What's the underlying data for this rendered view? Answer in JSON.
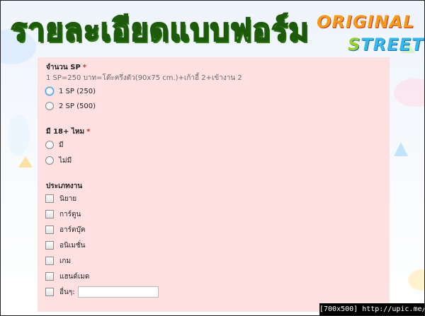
{
  "header": {
    "title": "รายละเอียดแบบฟอร์ม",
    "logo_line1": "ORIGINAL",
    "logo_line2_a": "S",
    "logo_line2_b": "TREET"
  },
  "form": {
    "q1": {
      "label": "จำนวน SP",
      "required_mark": "*",
      "help": "1 SP=250 บาท=โต๊ะครึ่งตัว(90x75 cm.)+เก้าอี้ 2+เข้างาน 2",
      "options": [
        "1 SP (250)",
        "2 SP (500)"
      ]
    },
    "q2": {
      "label": "มี 18+ ไหม",
      "required_mark": "*",
      "options": [
        "มี",
        "ไม่มี"
      ]
    },
    "q3": {
      "label": "ประเภทงาน",
      "options": [
        "นิยาย",
        "การ์ตูน",
        "อาร์ตบุ๊ค",
        "อนิเมชั่น",
        "เกม",
        "แฮนด์เมด",
        "อื่นๆ:"
      ],
      "other_value": ""
    }
  },
  "watermark": "[700x500] http://upic.me/",
  "colors": {
    "panel": "#fde0df",
    "title_green": "#4fc61c",
    "required": "#c0392b"
  }
}
